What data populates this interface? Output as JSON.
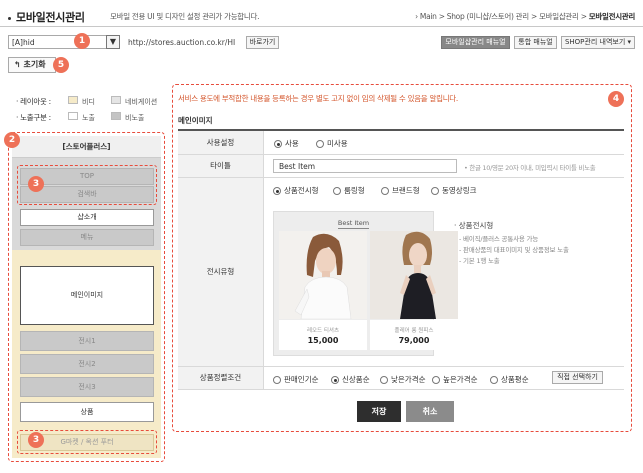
{
  "header": {
    "title": "모바일전시관리",
    "description": "모바일 전용 UI 및 디자인 설정 관리가 가능합니다.",
    "breadcrumb_prefix": "› Main > Shop (미니샵/스토어) 관리 > 모바일샵관리 >",
    "breadcrumb_current": "모바일전시관리"
  },
  "toolbar": {
    "shop_select_value": "[A]hid",
    "shop_url": "http://stores.auction.co.kr/HI",
    "goto_label": "바로가기",
    "manual_label": "모바일샵관리 매뉴얼",
    "integrated_manual_label": "통합 매뉴얼",
    "history_label": "SHOP관리 내역보기 ▾",
    "reset_label": "↰ 초기화"
  },
  "badges": {
    "b1": "1",
    "b2": "2",
    "b3": "3",
    "b4": "4",
    "b5": "5"
  },
  "legend": {
    "layout_label": "· 레이아웃 :",
    "layout_fixed": "비디",
    "layout_nav": "네비게이션",
    "exposure_label": "· 노출구분 :",
    "exposure_on": "노출",
    "exposure_off": "비노출"
  },
  "left_panel": {
    "header": "[스토어플러스]",
    "blocks": {
      "top": "TOP",
      "search": "검색바",
      "intro": "샵소개",
      "menu": "메뉴",
      "main_image": "메인이미지",
      "display1": "전시1",
      "display2": "전시2",
      "display3": "전시3",
      "product": "상품",
      "footer": "G마켓 / 옥션 푸터"
    }
  },
  "right_panel": {
    "notice": "서비스 용도에 부적합한 내용을 등록하는 경우 별도 고지 없이 임의 삭제될 수 있음을 알립니다.",
    "section_title": "메인이미지",
    "use_setting": {
      "label": "사용설정",
      "use": "사용",
      "unused": "미사용"
    },
    "title_row": {
      "label": "타이틀",
      "value": "Best Item",
      "hint": "• 한글 10/영문 20자 이내, 미입력시 타이틀 비노출"
    },
    "display_type": {
      "label": "전시유형",
      "options": [
        "상품전시형",
        "룸링형",
        "브랜드형",
        "동영상링크"
      ],
      "preview_title": "Best Item",
      "products": [
        {
          "name": "레오드 티셔츠",
          "price": "15,000"
        },
        {
          "name": "플레어 롱 원피스",
          "price": "79,000"
        }
      ],
      "desc_title": "· 상품전시형",
      "desc_items": [
        "- 베이직/플러스 공통사용 가능",
        "- 판매상품의 대표이미지 및 상품정보 노출",
        "- 기본 1행 노출"
      ]
    },
    "sort": {
      "label": "상품정렬조건",
      "options": [
        "판매인기순",
        "신상품순",
        "낮은가격순",
        "높은가격순",
        "상품평순"
      ],
      "direct_select": "직접 선택하기"
    },
    "save_label": "저장",
    "cancel_label": "취소"
  },
  "colors": {
    "accent": "#e74c3c",
    "badge": "#ee7158",
    "gray_zone": "#d9d9d9",
    "yellow_zone": "#f6ebc9",
    "notice_text": "#d4572d"
  }
}
